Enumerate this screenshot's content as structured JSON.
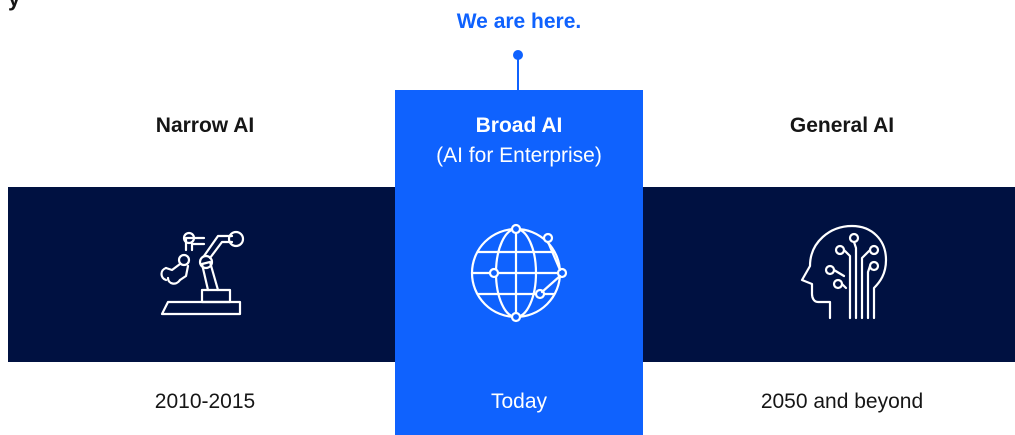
{
  "header": {
    "cut_text": "y"
  },
  "marker": {
    "label": "We are here."
  },
  "stages": {
    "narrow": {
      "title": "Narrow AI",
      "era": "2010-2015",
      "icon": "robot-arm-icon"
    },
    "broad": {
      "title": "Broad AI",
      "subtitle": "(AI for Enterprise)",
      "era": "Today",
      "icon": "globe-network-icon"
    },
    "general": {
      "title": "General AI",
      "era": "2050 and beyond",
      "icon": "brain-head-icon"
    }
  },
  "colors": {
    "band": "#001141",
    "highlight": "#0f62fe",
    "text": "#161616",
    "icon_stroke": "#ffffff"
  }
}
